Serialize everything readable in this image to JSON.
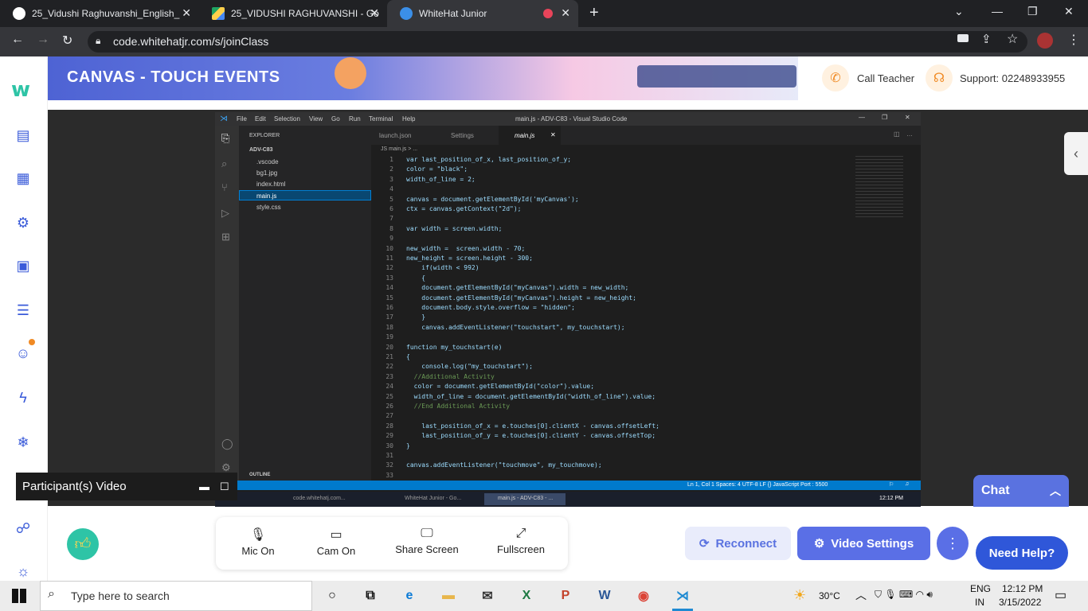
{
  "browser": {
    "tabs": [
      {
        "title": "25_Vidushi Raghuvanshi_English_",
        "icon": "github-icon"
      },
      {
        "title": "25_VIDUSHI RAGHUVANSHI - Go",
        "icon": "drive-icon"
      },
      {
        "title": "WhiteHat Junior",
        "icon": "whitehat-icon"
      }
    ],
    "url": "code.whitehatjr.com/s/joinClass"
  },
  "header": {
    "title": "CANVAS - TOUCH EVENTS",
    "call_teacher": "Call Teacher",
    "support": "Support: 02248933955"
  },
  "vscode": {
    "menu": [
      "File",
      "Edit",
      "Selection",
      "View",
      "Go",
      "Run",
      "Terminal",
      "Help"
    ],
    "window_title": "main.js - ADV-C83 - Visual Studio Code",
    "explorer_label": "EXPLORER",
    "project": "ADV-C83",
    "files": [
      ".vscode",
      "bg1.jpg",
      "index.html",
      "main.js",
      "style.css"
    ],
    "outline_label": "OUTLINE",
    "tabs": [
      "launch.json",
      "Settings",
      "main.js"
    ],
    "breadcrumb": "JS main.js > ...",
    "code_lines": [
      "var last_position_of_x, last_position_of_y;",
      "color = \"black\";",
      "width_of_line = 2;",
      "",
      "canvas = document.getElementById('myCanvas');",
      "ctx = canvas.getContext(\"2d\");",
      "",
      "var width = screen.width;",
      "",
      "new_width =  screen.width - 70;",
      "new_height = screen.height - 300;",
      "    if(width < 992)",
      "    {",
      "    document.getElementById(\"myCanvas\").width = new_width;",
      "    document.getElementById(\"myCanvas\").height = new_height;",
      "    document.body.style.overflow = \"hidden\";",
      "    }",
      "    canvas.addEventListener(\"touchstart\", my_touchstart);",
      "",
      "function my_touchstart(e)",
      "{",
      "    console.log(\"my_touchstart\");",
      "  //Additional Activity",
      "  color = document.getElementById(\"color\").value;",
      "  width_of_line = document.getElementById(\"width_of_line\").value;",
      "  //End Additional Activity",
      "",
      "    last_position_of_x = e.touches[0].clientX - canvas.offsetLeft;",
      "    last_position_of_y = e.touches[0].clientY - canvas.offsetTop;",
      "}",
      "",
      "canvas.addEventListener(\"touchmove\", my_touchmove);",
      ""
    ],
    "status": "Ln 1, Col 1   Spaces: 4   UTF-8   LF   {} JavaScript   Port : 5500",
    "inner_taskbar": [
      "code.whitehatj.com...",
      "WhiteHat Junior - Go...",
      "main.js - ADV-C83 - ..."
    ],
    "inner_time": "12:12 PM"
  },
  "participant_label": "Participant(s) Video",
  "controls": {
    "mic": "Mic On",
    "cam": "Cam On",
    "share": "Share Screen",
    "fullscreen": "Fullscreen"
  },
  "reconnect": "Reconnect",
  "video_settings": "Video Settings",
  "chat": "Chat",
  "need_help": "Need Help?",
  "taskbar": {
    "search_placeholder": "Type here to search",
    "weather": "30°C",
    "lang_top": "ENG",
    "lang_bottom": "IN",
    "time": "12:12 PM",
    "date": "3/15/2022"
  },
  "colors": {
    "accent": "#5a6fe6",
    "vscode_bg": "#1e1e1e",
    "status_blue": "#007acc"
  }
}
